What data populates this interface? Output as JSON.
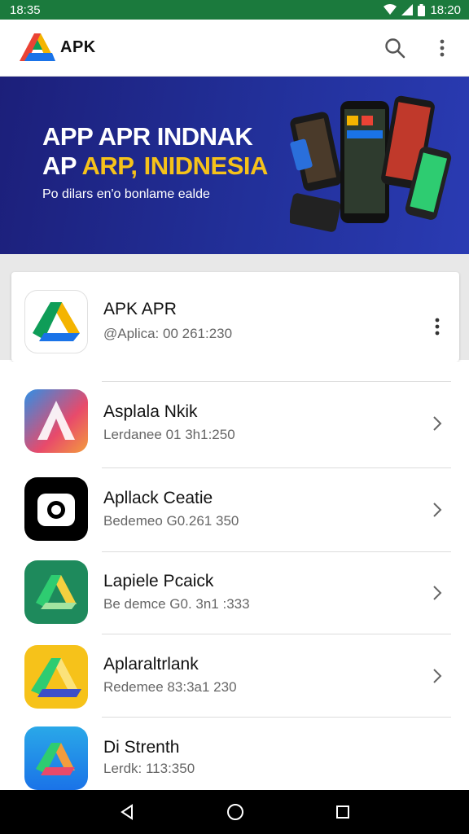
{
  "status_bar": {
    "time_left": "18:35",
    "time_right": "18:20"
  },
  "app_bar": {
    "brand": "APK",
    "search_icon": "search-icon",
    "more_icon": "more-vert-icon"
  },
  "banner": {
    "line1": "APP  APR INDNAK",
    "line2_prefix": "AP ",
    "line2_highlight": "ARP, INIDNESIA",
    "subtitle": "Po dilars en'o bonlame ealde",
    "highlight_color": "#f6c21a"
  },
  "featured": {
    "title": "APK APR",
    "subtitle": "@Aplica: 00 261:230"
  },
  "apps": [
    {
      "title": "Asplala Nkik",
      "subtitle": "Lerdanee 01 3h1:250"
    },
    {
      "title": "Apllack Ceatie",
      "subtitle": "Bedemeo G0.261 350"
    },
    {
      "title": "Lapiele Pcaick",
      "subtitle": "Be demce G0. 3n1 :333"
    },
    {
      "title": "Aplaraltrlank",
      "subtitle": "Redemee 83:3a1 230"
    },
    {
      "title": "Di Strenth",
      "subtitle": "Lerdk: 113:350"
    }
  ],
  "colors": {
    "status_bar": "#1b7a3d",
    "banner": "#22309a",
    "accent_yellow": "#f6c21a"
  }
}
